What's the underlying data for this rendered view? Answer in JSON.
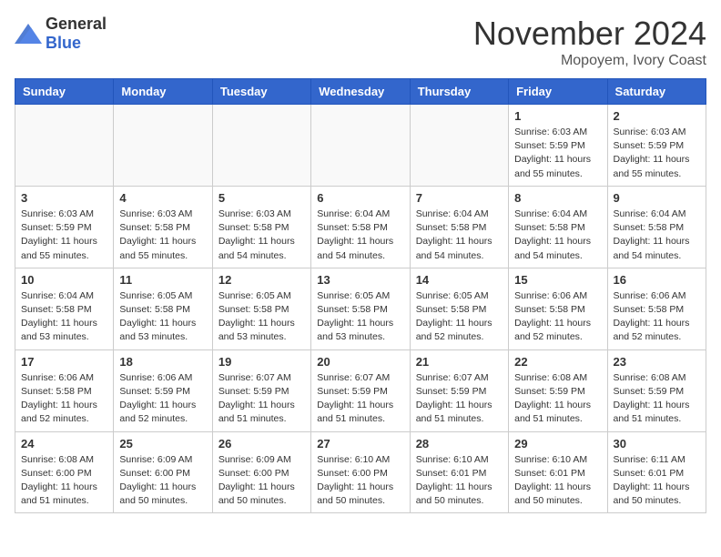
{
  "header": {
    "logo_general": "General",
    "logo_blue": "Blue",
    "month_title": "November 2024",
    "location": "Mopoyem, Ivory Coast"
  },
  "days_of_week": [
    "Sunday",
    "Monday",
    "Tuesday",
    "Wednesday",
    "Thursday",
    "Friday",
    "Saturday"
  ],
  "weeks": [
    [
      {
        "day": "",
        "info": ""
      },
      {
        "day": "",
        "info": ""
      },
      {
        "day": "",
        "info": ""
      },
      {
        "day": "",
        "info": ""
      },
      {
        "day": "",
        "info": ""
      },
      {
        "day": "1",
        "info": "Sunrise: 6:03 AM\nSunset: 5:59 PM\nDaylight: 11 hours and 55 minutes."
      },
      {
        "day": "2",
        "info": "Sunrise: 6:03 AM\nSunset: 5:59 PM\nDaylight: 11 hours and 55 minutes."
      }
    ],
    [
      {
        "day": "3",
        "info": "Sunrise: 6:03 AM\nSunset: 5:59 PM\nDaylight: 11 hours and 55 minutes."
      },
      {
        "day": "4",
        "info": "Sunrise: 6:03 AM\nSunset: 5:58 PM\nDaylight: 11 hours and 55 minutes."
      },
      {
        "day": "5",
        "info": "Sunrise: 6:03 AM\nSunset: 5:58 PM\nDaylight: 11 hours and 54 minutes."
      },
      {
        "day": "6",
        "info": "Sunrise: 6:04 AM\nSunset: 5:58 PM\nDaylight: 11 hours and 54 minutes."
      },
      {
        "day": "7",
        "info": "Sunrise: 6:04 AM\nSunset: 5:58 PM\nDaylight: 11 hours and 54 minutes."
      },
      {
        "day": "8",
        "info": "Sunrise: 6:04 AM\nSunset: 5:58 PM\nDaylight: 11 hours and 54 minutes."
      },
      {
        "day": "9",
        "info": "Sunrise: 6:04 AM\nSunset: 5:58 PM\nDaylight: 11 hours and 54 minutes."
      }
    ],
    [
      {
        "day": "10",
        "info": "Sunrise: 6:04 AM\nSunset: 5:58 PM\nDaylight: 11 hours and 53 minutes."
      },
      {
        "day": "11",
        "info": "Sunrise: 6:05 AM\nSunset: 5:58 PM\nDaylight: 11 hours and 53 minutes."
      },
      {
        "day": "12",
        "info": "Sunrise: 6:05 AM\nSunset: 5:58 PM\nDaylight: 11 hours and 53 minutes."
      },
      {
        "day": "13",
        "info": "Sunrise: 6:05 AM\nSunset: 5:58 PM\nDaylight: 11 hours and 53 minutes."
      },
      {
        "day": "14",
        "info": "Sunrise: 6:05 AM\nSunset: 5:58 PM\nDaylight: 11 hours and 52 minutes."
      },
      {
        "day": "15",
        "info": "Sunrise: 6:06 AM\nSunset: 5:58 PM\nDaylight: 11 hours and 52 minutes."
      },
      {
        "day": "16",
        "info": "Sunrise: 6:06 AM\nSunset: 5:58 PM\nDaylight: 11 hours and 52 minutes."
      }
    ],
    [
      {
        "day": "17",
        "info": "Sunrise: 6:06 AM\nSunset: 5:58 PM\nDaylight: 11 hours and 52 minutes."
      },
      {
        "day": "18",
        "info": "Sunrise: 6:06 AM\nSunset: 5:59 PM\nDaylight: 11 hours and 52 minutes."
      },
      {
        "day": "19",
        "info": "Sunrise: 6:07 AM\nSunset: 5:59 PM\nDaylight: 11 hours and 51 minutes."
      },
      {
        "day": "20",
        "info": "Sunrise: 6:07 AM\nSunset: 5:59 PM\nDaylight: 11 hours and 51 minutes."
      },
      {
        "day": "21",
        "info": "Sunrise: 6:07 AM\nSunset: 5:59 PM\nDaylight: 11 hours and 51 minutes."
      },
      {
        "day": "22",
        "info": "Sunrise: 6:08 AM\nSunset: 5:59 PM\nDaylight: 11 hours and 51 minutes."
      },
      {
        "day": "23",
        "info": "Sunrise: 6:08 AM\nSunset: 5:59 PM\nDaylight: 11 hours and 51 minutes."
      }
    ],
    [
      {
        "day": "24",
        "info": "Sunrise: 6:08 AM\nSunset: 6:00 PM\nDaylight: 11 hours and 51 minutes."
      },
      {
        "day": "25",
        "info": "Sunrise: 6:09 AM\nSunset: 6:00 PM\nDaylight: 11 hours and 50 minutes."
      },
      {
        "day": "26",
        "info": "Sunrise: 6:09 AM\nSunset: 6:00 PM\nDaylight: 11 hours and 50 minutes."
      },
      {
        "day": "27",
        "info": "Sunrise: 6:10 AM\nSunset: 6:00 PM\nDaylight: 11 hours and 50 minutes."
      },
      {
        "day": "28",
        "info": "Sunrise: 6:10 AM\nSunset: 6:01 PM\nDaylight: 11 hours and 50 minutes."
      },
      {
        "day": "29",
        "info": "Sunrise: 6:10 AM\nSunset: 6:01 PM\nDaylight: 11 hours and 50 minutes."
      },
      {
        "day": "30",
        "info": "Sunrise: 6:11 AM\nSunset: 6:01 PM\nDaylight: 11 hours and 50 minutes."
      }
    ]
  ]
}
